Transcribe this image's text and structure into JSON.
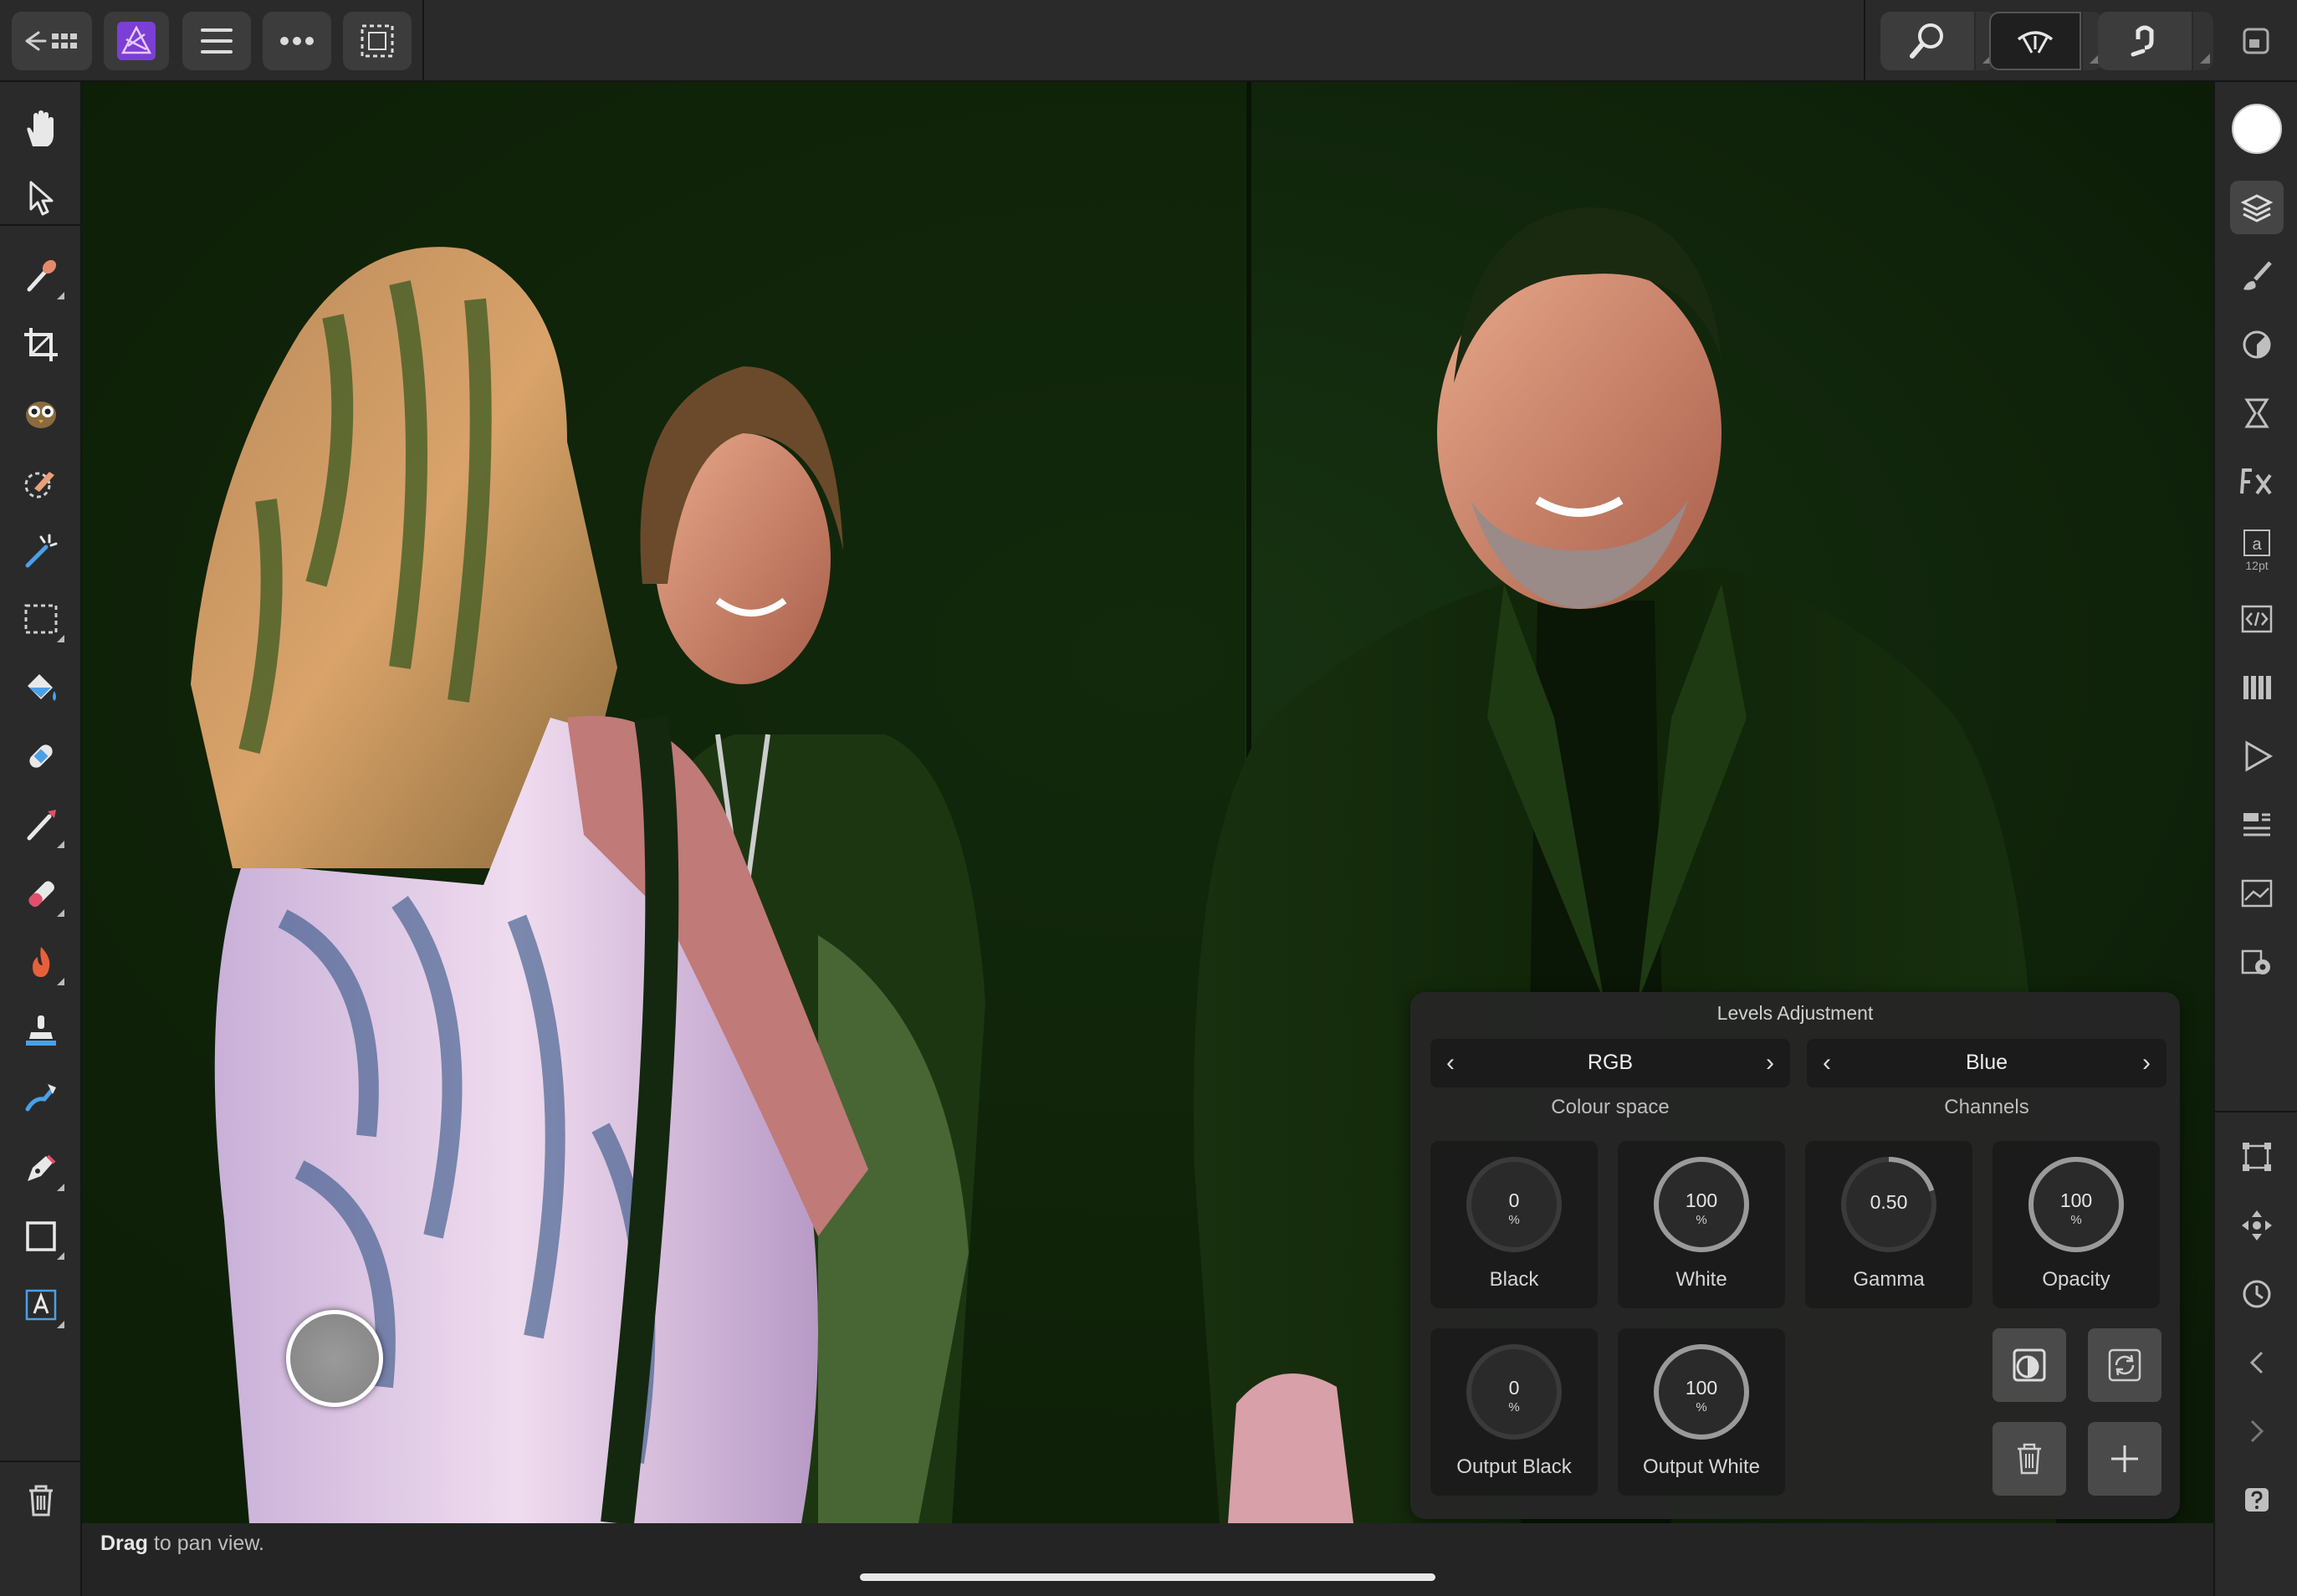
{
  "status": {
    "drag": "Drag",
    "message": " to pan view."
  },
  "levels_panel": {
    "title": "Levels Adjustment",
    "colour_space": {
      "value": "RGB",
      "label": "Colour space"
    },
    "channels": {
      "value": "Blue",
      "label": "Channels"
    },
    "black": {
      "value": "0",
      "unit": "%",
      "label": "Black",
      "level": 0
    },
    "white": {
      "value": "100",
      "unit": "%",
      "label": "White",
      "level": 1
    },
    "gamma": {
      "value": "0.50",
      "unit": "",
      "label": "Gamma",
      "level": 0.2
    },
    "opacity": {
      "value": "100",
      "unit": "%",
      "label": "Opacity",
      "level": 1
    },
    "output_black": {
      "value": "0",
      "unit": "%",
      "label": "Output Black",
      "level": 0
    },
    "output_white": {
      "value": "100",
      "unit": "%",
      "label": "Output White",
      "level": 1
    }
  },
  "right_bar": {
    "text_style_size": "12pt"
  },
  "colors": {
    "accent_purple": "#8a4fd8",
    "canvas_green": "#0e1f08",
    "panel_bg": "#262626"
  },
  "icons": {
    "topbar": [
      "back-to-documents-icon",
      "app-logo-icon",
      "menu-icon",
      "more-icon",
      "selection-icon",
      "zoom-icon",
      "view-mode-icon",
      "snapping-icon",
      "window-icon"
    ],
    "left_tools": [
      "hand-tool-icon",
      "move-tool-icon",
      "colour-picker-icon",
      "crop-tool-icon",
      "liquify-tool-icon",
      "selection-brush-icon",
      "flood-select-icon",
      "marquee-icon",
      "fill-tool-icon",
      "inpainting-icon",
      "paint-brush-icon",
      "eraser-icon",
      "burn-tool-icon",
      "clone-tool-icon",
      "smudge-tool-icon",
      "pen-tool-icon",
      "rectangle-tool-icon",
      "text-tool-icon",
      "delete-icon"
    ],
    "right_studio": [
      "colour-swatch",
      "layers-icon",
      "brushes-icon",
      "adjustments-icon",
      "effects-icon",
      "fx-icon",
      "text-styles-icon",
      "source-icon",
      "channels-icon",
      "macro-icon",
      "history-icon",
      "navigator-icon",
      "settings-icon",
      "transform-icon",
      "move-icon",
      "history-clock-icon",
      "chevron-left-icon",
      "chevron-right-icon",
      "help-icon"
    ]
  }
}
